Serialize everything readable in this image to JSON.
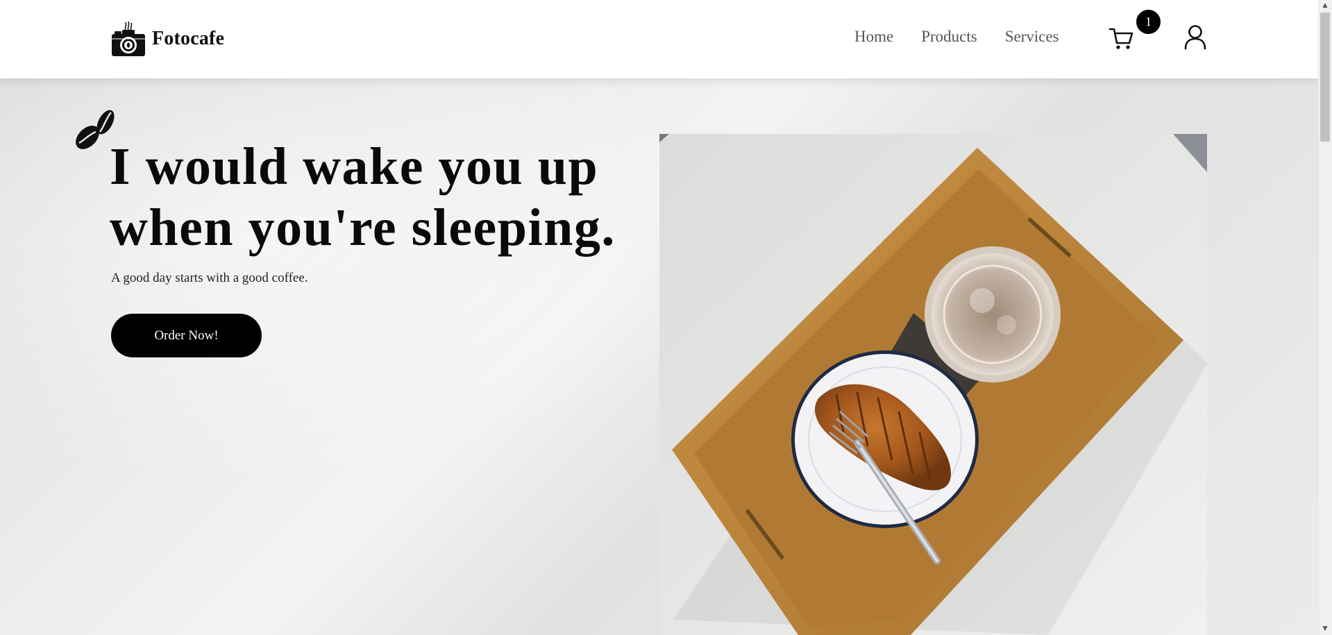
{
  "brand": {
    "name": "Fotocafe",
    "logo_icon": "camera-coffee-icon"
  },
  "nav": {
    "links": [
      {
        "label": "Home"
      },
      {
        "label": "Products"
      },
      {
        "label": "Services"
      }
    ],
    "cart_icon": "cart-icon",
    "cart_count": "1",
    "user_icon": "user-icon"
  },
  "hero": {
    "decor_icon": "coffee-beans-icon",
    "title_line1": "I would wake you up",
    "title_line2": "when you're sleeping.",
    "subtitle": "A good day starts with a good coffee.",
    "cta_label": "Order Now!",
    "image_subject": "coffee-and-croissant-on-tray"
  },
  "colors": {
    "primary": "#000000",
    "nav_text": "#555555",
    "background": "#ececec",
    "navbar_bg": "#ffffff"
  }
}
